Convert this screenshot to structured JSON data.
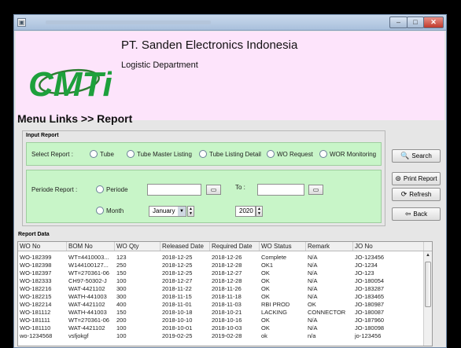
{
  "header": {
    "company": "PT. Sanden Electronics Indonesia",
    "department": "Logistic Department",
    "logo_text": "CMTi"
  },
  "breadcrumb": "Menu Links  >>  Report",
  "input_report": {
    "title": "Input Report",
    "select_label": "Select Report   :",
    "report_options": [
      "Tube",
      "Tube Master Listing",
      "Tube Listing Detail",
      "WO Request",
      "WOR Monitoring"
    ],
    "periode_label": "Periode Report   :",
    "periode_option": "Periode",
    "to_label": "To :",
    "month_option": "Month",
    "month_value": "January",
    "year_value": "2020"
  },
  "buttons": {
    "search": "Search",
    "print_report": "Print Report",
    "refresh": "Refresh",
    "back": "Back"
  },
  "report_data": {
    "title": "Report Data",
    "columns": [
      "WO No",
      "BOM No",
      "WO Qty",
      "Released Date",
      "Required Date",
      "WO Status",
      "Remark",
      "JO No"
    ],
    "rows": [
      [
        "WO-182399",
        "WT=4410003...",
        "123",
        "2018-12-25",
        "2018-12-26",
        "Complete",
        "N/A",
        "JO-123456"
      ],
      [
        "WO-182398",
        "W144100127...",
        "250",
        "2018-12-25",
        "2018-12-28",
        "OK1",
        "N/A",
        "JO-1234"
      ],
      [
        "WO-182397",
        "WT=270361-06",
        "150",
        "2018-12-25",
        "2018-12-27",
        "OK",
        "N/A",
        "JO-123"
      ],
      [
        "WO-182333",
        "CH97-50302-J",
        "100",
        "2018-12-27",
        "2018-12-28",
        "OK",
        "N/A",
        "JO-180054"
      ],
      [
        "WO-182216",
        "WAT-4421102",
        "300",
        "2018-11-22",
        "2018-11-26",
        "OK",
        "N/A",
        "JO-183287"
      ],
      [
        "WO-182215",
        "WATH-441003",
        "300",
        "2018-11-15",
        "2018-11-18",
        "OK",
        "N/A",
        "JO-183465"
      ],
      [
        "WO-182214",
        "WAT-4421102",
        "400",
        "2018-11-01",
        "2018-11-03",
        "RBI PROD",
        "OK",
        "JO-180987"
      ],
      [
        "WO-181112",
        "WATH-441003",
        "150",
        "2018-10-18",
        "2018-10-21",
        "LACKING",
        "CONNECTOR",
        "JO-180087"
      ],
      [
        "WO-181111",
        "WT=270361-06",
        "200",
        "2018-10-10",
        "2018-10-16",
        "OK",
        "N/A",
        "JO-187960"
      ],
      [
        "WO-181110",
        "WAT-4421102",
        "100",
        "2018-10-01",
        "2018-10-03",
        "OK",
        "N/A",
        "JO-180098"
      ],
      [
        "wo-1234568",
        "vsfjokgf",
        "100",
        "2019-02-25",
        "2019-02-28",
        "ok",
        "n/a",
        "jo-123456"
      ]
    ]
  }
}
